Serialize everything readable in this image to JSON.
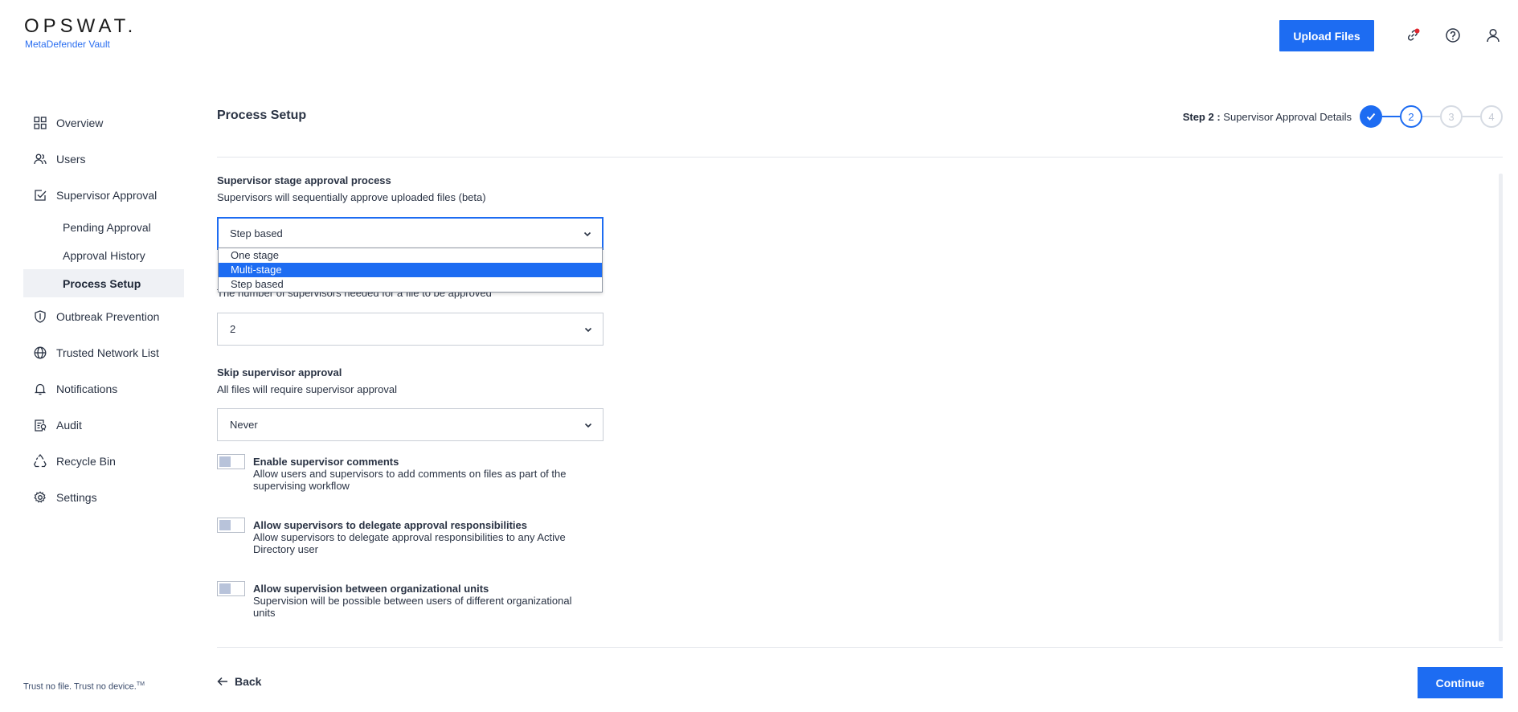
{
  "brand": {
    "name": "OPSWAT.",
    "product": "MetaDefender Vault",
    "tagline": "Trust no file. Trust no device.",
    "tagline_mark": "TM"
  },
  "header": {
    "upload_label": "Upload Files",
    "icons": [
      "link-notification-icon",
      "help-icon",
      "user-icon"
    ]
  },
  "colors": {
    "accent": "#1d6cf2",
    "text": "#2a3344",
    "notification_dot": "#e0262e"
  },
  "sidebar": {
    "items": [
      {
        "label": "Overview",
        "icon": "grid-icon"
      },
      {
        "label": "Users",
        "icon": "users-icon"
      },
      {
        "label": "Supervisor Approval",
        "icon": "checkbox-icon"
      },
      {
        "label": "Outbreak Prevention",
        "icon": "shield-icon"
      },
      {
        "label": "Trusted Network List",
        "icon": "globe-icon"
      },
      {
        "label": "Notifications",
        "icon": "bell-icon"
      },
      {
        "label": "Audit",
        "icon": "audit-icon"
      },
      {
        "label": "Recycle Bin",
        "icon": "recycle-icon"
      },
      {
        "label": "Settings",
        "icon": "gear-icon"
      }
    ],
    "sub_items": [
      {
        "label": "Pending Approval"
      },
      {
        "label": "Approval History"
      },
      {
        "label": "Process Setup",
        "active": true
      }
    ]
  },
  "main": {
    "title": "Process Setup",
    "stepper": {
      "prefix": "Step 2 :",
      "label": "Supervisor Approval Details",
      "steps": [
        "",
        "2",
        "3",
        "4"
      ],
      "current": 2
    },
    "approval_process": {
      "title": "Supervisor stage approval process",
      "description": "Supervisors will sequentially approve uploaded files (beta)",
      "value": "Step based",
      "options": [
        "One stage",
        "Multi-stage",
        "Step based"
      ],
      "highlighted": "Multi-stage"
    },
    "supervisors_needed": {
      "description": "The number of supervisors needed for a file to be approved",
      "value": "2"
    },
    "skip_approval": {
      "title": "Skip supervisor approval",
      "description": "All files will require supervisor approval",
      "value": "Never"
    },
    "toggles": [
      {
        "title": "Enable supervisor comments",
        "description": "Allow users and supervisors to add comments on files as part of the supervising workflow"
      },
      {
        "title": "Allow supervisors to delegate approval responsibilities",
        "description": "Allow supervisors to delegate approval responsibilities to any Active Directory user"
      },
      {
        "title": "Allow supervision between organizational units",
        "description": "Supervision will be possible between users of different organizational units"
      }
    ],
    "back_label": "Back",
    "continue_label": "Continue"
  }
}
